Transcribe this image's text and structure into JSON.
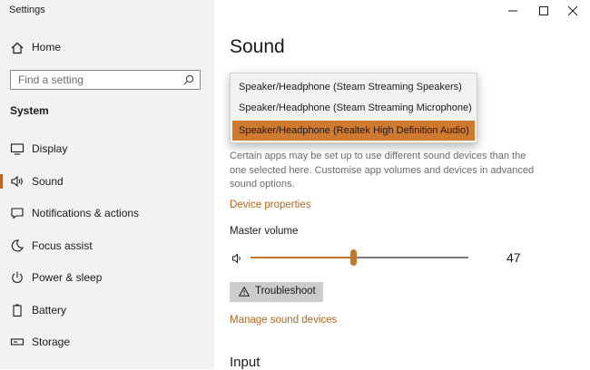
{
  "window": {
    "title": "Settings"
  },
  "sidebar": {
    "home_label": "Home",
    "search_placeholder": "Find a setting",
    "section_title": "System",
    "items": [
      {
        "label": "Display",
        "icon": "display-icon",
        "active": false
      },
      {
        "label": "Sound",
        "icon": "speaker-icon",
        "active": true
      },
      {
        "label": "Notifications & actions",
        "icon": "notification-icon",
        "active": false
      },
      {
        "label": "Focus assist",
        "icon": "moon-icon",
        "active": false
      },
      {
        "label": "Power & sleep",
        "icon": "power-icon",
        "active": false
      },
      {
        "label": "Battery",
        "icon": "battery-icon",
        "active": false
      },
      {
        "label": "Storage",
        "icon": "storage-icon",
        "active": false
      }
    ]
  },
  "main": {
    "title": "Sound",
    "output_dropdown": {
      "options": [
        "Speaker/Headphone (Steam Streaming Speakers)",
        "Speaker/Headphone (Steam Streaming Microphone)",
        "Speaker/Headphone (Realtek High Definition Audio)"
      ],
      "selected_index": 2
    },
    "description": "Certain apps may be set up to use different sound devices than the one selected here. Customise app volumes and devices in advanced sound options.",
    "device_properties_link": "Device properties",
    "master_volume_label": "Master volume",
    "master_volume_value": "47",
    "master_volume_level": 47,
    "troubleshoot_label": "Troubleshoot",
    "manage_devices_link": "Manage sound devices",
    "input_heading": "Input"
  },
  "colors": {
    "accent": "#c0772f",
    "link": "#b4651f",
    "sidebar_bg": "#f2f2f2",
    "dropdown_selected": "#d07a2f"
  }
}
